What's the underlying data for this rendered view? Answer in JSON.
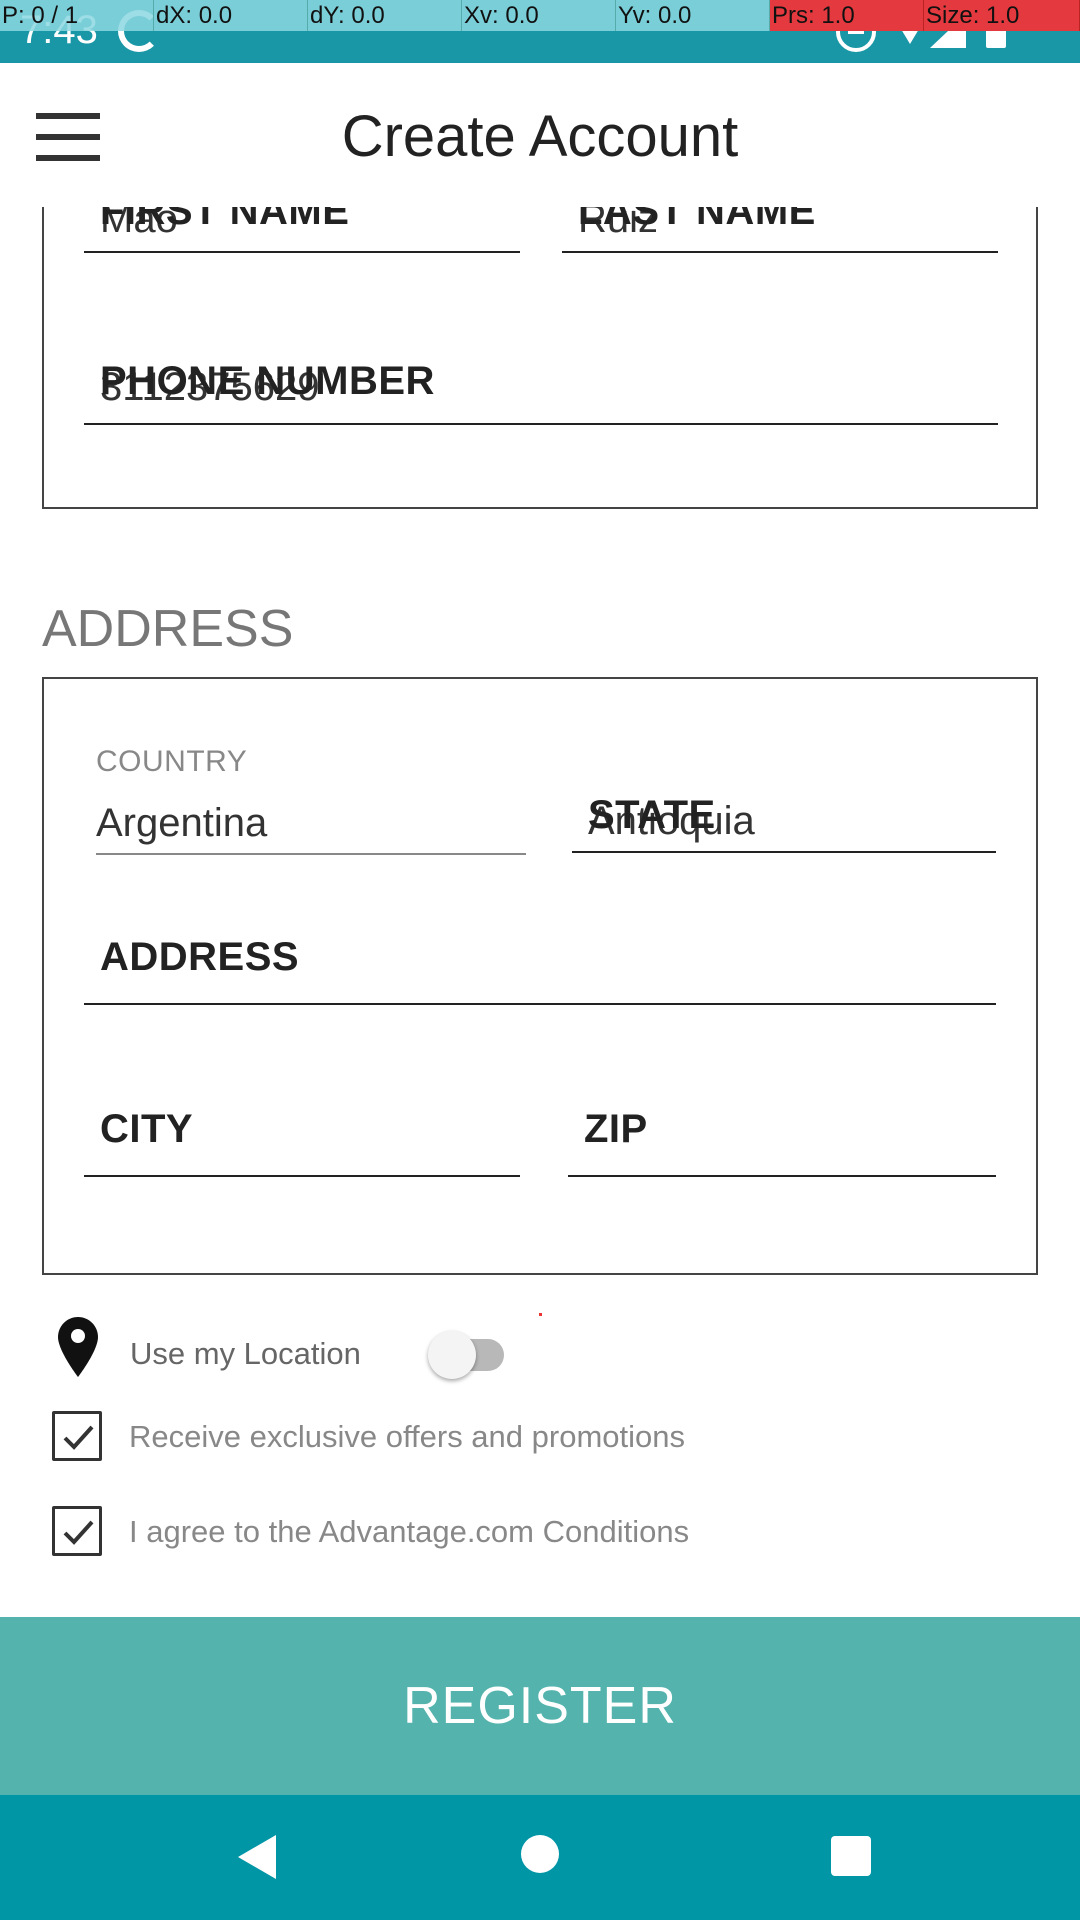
{
  "status_bar": {
    "time": "7:43",
    "icons": [
      "sync-icon",
      "dnd-icon",
      "wifi-icon",
      "signal-icon",
      "battery-icon"
    ]
  },
  "debug_overlay": [
    "P: 0 / 1",
    "dX: 0.0",
    "dY: 0.0",
    "Xv: 0.0",
    "Yv: 0.0",
    "Prs: 1.0",
    "Size: 1.0"
  ],
  "toolbar": {
    "menu_icon": "menu-icon",
    "title": "Create Account"
  },
  "account_details": {
    "first_name": {
      "label": "FIRST NAME",
      "value": "Mao"
    },
    "last_name": {
      "label": "LAST NAME",
      "value": "Ruiz"
    },
    "phone": {
      "label": "PHONE NUMBER",
      "value": "3112375629"
    }
  },
  "address_section": {
    "title": "ADDRESS",
    "country": {
      "label": "COUNTRY",
      "value": "Argentina"
    },
    "state": {
      "label": "STATE",
      "value": "Antioquia"
    },
    "address": {
      "label": "ADDRESS"
    },
    "city": {
      "label": "CITY"
    },
    "zip": {
      "label": "ZIP"
    }
  },
  "location": {
    "icon": "map-pin-icon",
    "label": "Use my Location",
    "enabled": false
  },
  "checkboxes": [
    {
      "label": "Receive exclusive offers and promotions",
      "checked": true
    },
    {
      "label": "I agree to the Advantage.com Conditions",
      "checked": true
    }
  ],
  "register": {
    "label": "REGISTER"
  },
  "nav_bar": {
    "icons": [
      "back-icon",
      "home-icon",
      "recents-icon"
    ]
  },
  "colors": {
    "status_bar": "#1a97a6",
    "register_button": "#54b3ad",
    "nav_bar": "#0096a6",
    "debug_alert": "#e43a3f"
  }
}
